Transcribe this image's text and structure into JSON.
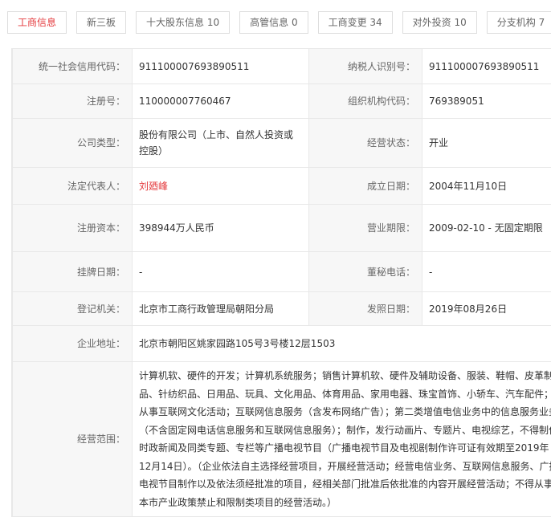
{
  "tabs": [
    "工商信息",
    "新三板",
    "十大股东信息 10",
    "高管信息 0",
    "工商变更 34",
    "对外投资 10",
    "分支机构 7"
  ],
  "rows": {
    "credit_code_label": "统一社会信用代码：",
    "credit_code": "911100007693890511",
    "taxpayer_label": "纳税人识别号：",
    "taxpayer": "911100007693890511",
    "reg_no_label": "注册号：",
    "reg_no": "110000007760467",
    "org_code_label": "组织机构代码：",
    "org_code": "769389051",
    "type_label": "公司类型：",
    "type": "股份有限公司（上市、自然人投资或控股）",
    "status_label": "经营状态：",
    "status": "开业",
    "legal_label": "法定代表人：",
    "legal": "刘廼峰",
    "founded_label": "成立日期：",
    "founded": "2004年11月10日",
    "capital_label": "注册资本：",
    "capital": "398944万人民币",
    "term_label": "营业期限：",
    "term": "2009-02-10 - 无固定期限",
    "listing_label": "挂牌日期：",
    "listing": "-",
    "secretary_label": "董秘电话：",
    "secretary": "-",
    "authority_label": "登记机关：",
    "authority": "北京市工商行政管理局朝阳分局",
    "issue_label": "发照日期：",
    "issue": "2019年08月26日",
    "address_label": "企业地址：",
    "address": "北京市朝阳区姚家园路105号3号楼12层1503",
    "scope_label": "经营范围：",
    "scope": "计算机软、硬件的开发；计算机系统服务；销售计算机软、硬件及辅助设备、服装、鞋帽、皮革制品、针纺织品、日用品、玩具、文化用品、体育用品、家用电器、珠宝首饰、小轿车、汽车配件；从事互联网文化活动；互联网信息服务（含发布网络广告）；第二类增值电信业务中的信息服务业务（不含固定网电话信息服务和互联网信息服务）；制作，发行动画片、专题片、电视综艺，不得制作时政新闻及同类专题、专栏等广播电视节目（广播电视节目及电视剧制作许可证有效期至2019年12月14日）。（企业依法自主选择经营项目，开展经营活动；经营电信业务、互联网信息服务、广播电视节目制作以及依法须经批准的项目，经相关部门批准后依批准的内容开展经营活动；不得从事本市产业政策禁止和限制类项目的经营活动。）"
  }
}
